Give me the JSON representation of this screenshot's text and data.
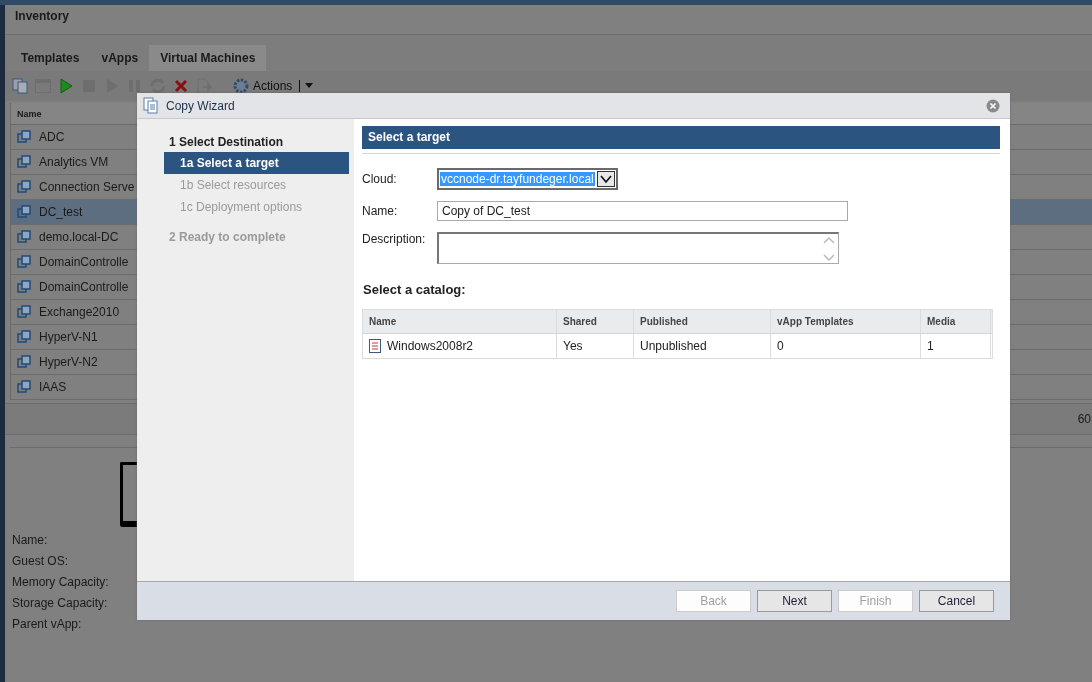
{
  "app": {
    "title": "Inventory",
    "tabs": [
      {
        "label": "Templates",
        "selected": false
      },
      {
        "label": "vApps",
        "selected": false
      },
      {
        "label": "Virtual Machines",
        "selected": true
      }
    ],
    "toolbar": {
      "buttons": [
        {
          "kind": "copy",
          "disabled": false
        },
        {
          "kind": "console",
          "disabled": true
        },
        {
          "kind": "play",
          "disabled": false
        },
        {
          "kind": "stop",
          "disabled": true
        },
        {
          "kind": "play",
          "disabled": true
        },
        {
          "kind": "pause",
          "disabled": true
        },
        {
          "kind": "refresh",
          "disabled": true
        },
        {
          "kind": "delete",
          "disabled": false
        },
        {
          "kind": "export",
          "disabled": true
        }
      ],
      "actions_label": "Actions"
    },
    "vm_table": {
      "columns": [
        "Name"
      ],
      "rows": [
        {
          "name": "ADC",
          "selected": false
        },
        {
          "name": "Analytics VM",
          "selected": false
        },
        {
          "name": "Connection Serve",
          "selected": false
        },
        {
          "name": "DC_test",
          "selected": true
        },
        {
          "name": "demo.local-DC",
          "selected": false
        },
        {
          "name": "DomainControlle",
          "selected": false
        },
        {
          "name": "DomainControlle",
          "selected": false
        },
        {
          "name": "Exchange2010",
          "selected": false
        },
        {
          "name": "HyperV-N1",
          "selected": false
        },
        {
          "name": "HyperV-N2",
          "selected": false
        },
        {
          "name": "IAAS",
          "selected": false
        }
      ]
    },
    "footer_count": "60",
    "details": [
      "Name:",
      "Guest OS:",
      "Memory Capacity:",
      "Storage Capacity:",
      "Parent vApp:"
    ]
  },
  "wizard": {
    "title": "Copy Wizard",
    "steps": [
      {
        "label": "1 Select Destination",
        "disabled": false,
        "children": [
          {
            "label": "1a Select a target",
            "selected": true,
            "disabled": false
          },
          {
            "label": "1b Select resources",
            "selected": false,
            "disabled": true
          },
          {
            "label": "1c Deployment options",
            "selected": false,
            "disabled": true
          }
        ]
      },
      {
        "label": "2 Ready to complete",
        "disabled": true
      }
    ],
    "page_title": "Select a target",
    "cloud": {
      "label": "Cloud:",
      "value": "vccnode-dr.tayfundeger.local"
    },
    "name": {
      "label": "Name:",
      "value": "Copy of DC_test"
    },
    "description": {
      "label": "Description:"
    },
    "catalog_title": "Select a catalog:",
    "catalog_table": {
      "columns": [
        "Name",
        "Shared",
        "Published",
        "vApp Templates",
        "Media"
      ],
      "rows": [
        {
          "cells": [
            "Windows2008r2",
            "Yes",
            "Unpublished",
            "0",
            "1"
          ],
          "selected": false
        }
      ]
    },
    "buttons": [
      {
        "label": "Back",
        "disabled": true
      },
      {
        "label": "Next",
        "disabled": false
      },
      {
        "label": "Finish",
        "disabled": true
      },
      {
        "label": "Cancel",
        "disabled": false
      }
    ]
  }
}
